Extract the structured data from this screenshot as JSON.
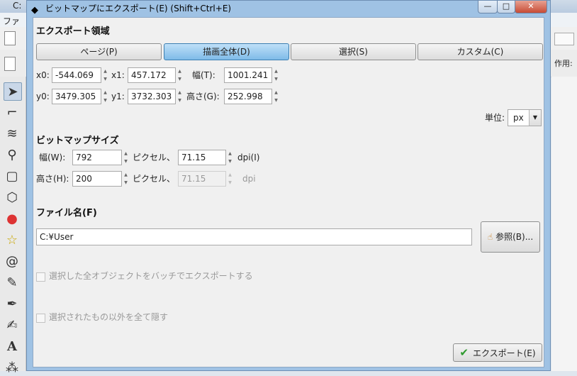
{
  "background_app": {
    "title_fragment": "C:",
    "menu_fragment": "ファ",
    "toolbar_fragment": "作用:"
  },
  "dialog": {
    "title": "ビットマップにエクスポート(E) (Shift+Ctrl+E)",
    "window_buttons": {
      "minimize": "—",
      "maximize": "□",
      "close": "✕"
    }
  },
  "export_area": {
    "heading": "エクスポート領域",
    "buttons": [
      "ページ(P)",
      "描画全体(D)",
      "選択(S)",
      "カスタム(C)"
    ],
    "active_index": 1,
    "fields": {
      "x0": {
        "label": "x0:",
        "value": "-544.069"
      },
      "x1": {
        "label": "x1:",
        "value": "457.172"
      },
      "width": {
        "label": "幅(T):",
        "value": "1001.241"
      },
      "y0": {
        "label": "y0:",
        "value": "3479.305"
      },
      "y1": {
        "label": "y1:",
        "value": "3732.303"
      },
      "height": {
        "label": "高さ(G):",
        "value": "252.998"
      }
    },
    "units_label": "単位:",
    "units_value": "px"
  },
  "bitmap_size": {
    "heading": "ビットマップサイズ",
    "width_label": "幅(W):",
    "width_value": "792",
    "pixel_label1": "ピクセル、",
    "dpi_value": "71.15",
    "dpi_label": "dpi(I)",
    "height_label": "高さ(H):",
    "height_value": "200",
    "pixel_label2": "ピクセル、",
    "dpi_value2": "71.15",
    "dpi_label2": "dpi"
  },
  "file": {
    "heading": "ファイル名(F)",
    "path": "C:¥User",
    "browse_label": "参照(B)..."
  },
  "options": {
    "batch_label": "選択した全オブジェクトをバッチでエクスポートする",
    "hide_label": "選択されたもの以外を全て隠す"
  },
  "export_button_label": "エクスポート(E)",
  "colors": {
    "active_button": "#7fbbe8",
    "dialog_frame": "#9fc2e4",
    "check": "#2f9a2f"
  }
}
